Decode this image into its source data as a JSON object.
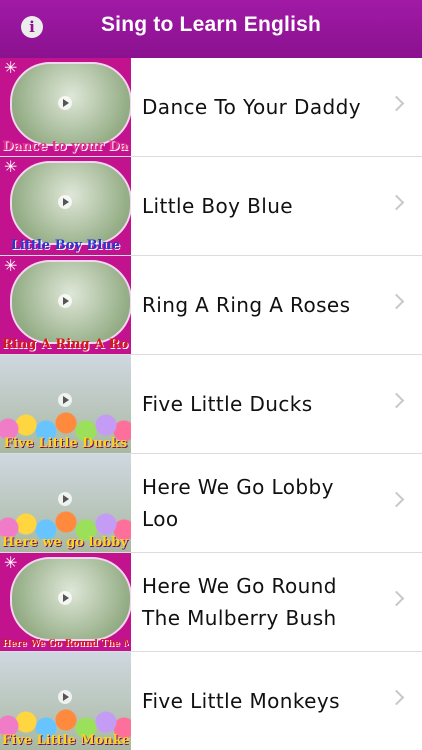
{
  "navbar": {
    "title": "Sing to Learn English",
    "info_label": "i"
  },
  "songs": [
    {
      "title": "Dance To Your Daddy",
      "thumb_caption": "Dance to your Daddy",
      "thumb_icon": "sparkle-icon"
    },
    {
      "title": "Little Boy Blue",
      "thumb_caption": "Little Boy Blue",
      "thumb_icon": "sparkle-icon"
    },
    {
      "title": "Ring A Ring A Roses",
      "thumb_caption": "Ring A Ring A Roses",
      "thumb_icon": "sparkle-icon"
    },
    {
      "title": "Five Little Ducks",
      "thumb_caption": "Five Little Ducks"
    },
    {
      "title": "Here We Go Lobby Loo",
      "thumb_caption": "Here we go lobby loo"
    },
    {
      "title": "Here We Go Round The Mulberry Bush",
      "thumb_caption": "Here We Go Round The Mulberry Bush",
      "thumb_icon": "sparkle-icon"
    },
    {
      "title": "Five Little Monkeys",
      "thumb_caption": "Five Little Monkeys"
    }
  ],
  "colors": {
    "navbar": "#8a118f",
    "thumb_frame": "#c2128d",
    "separator": "#dcdcdc",
    "chevron": "#c7c7cc"
  }
}
